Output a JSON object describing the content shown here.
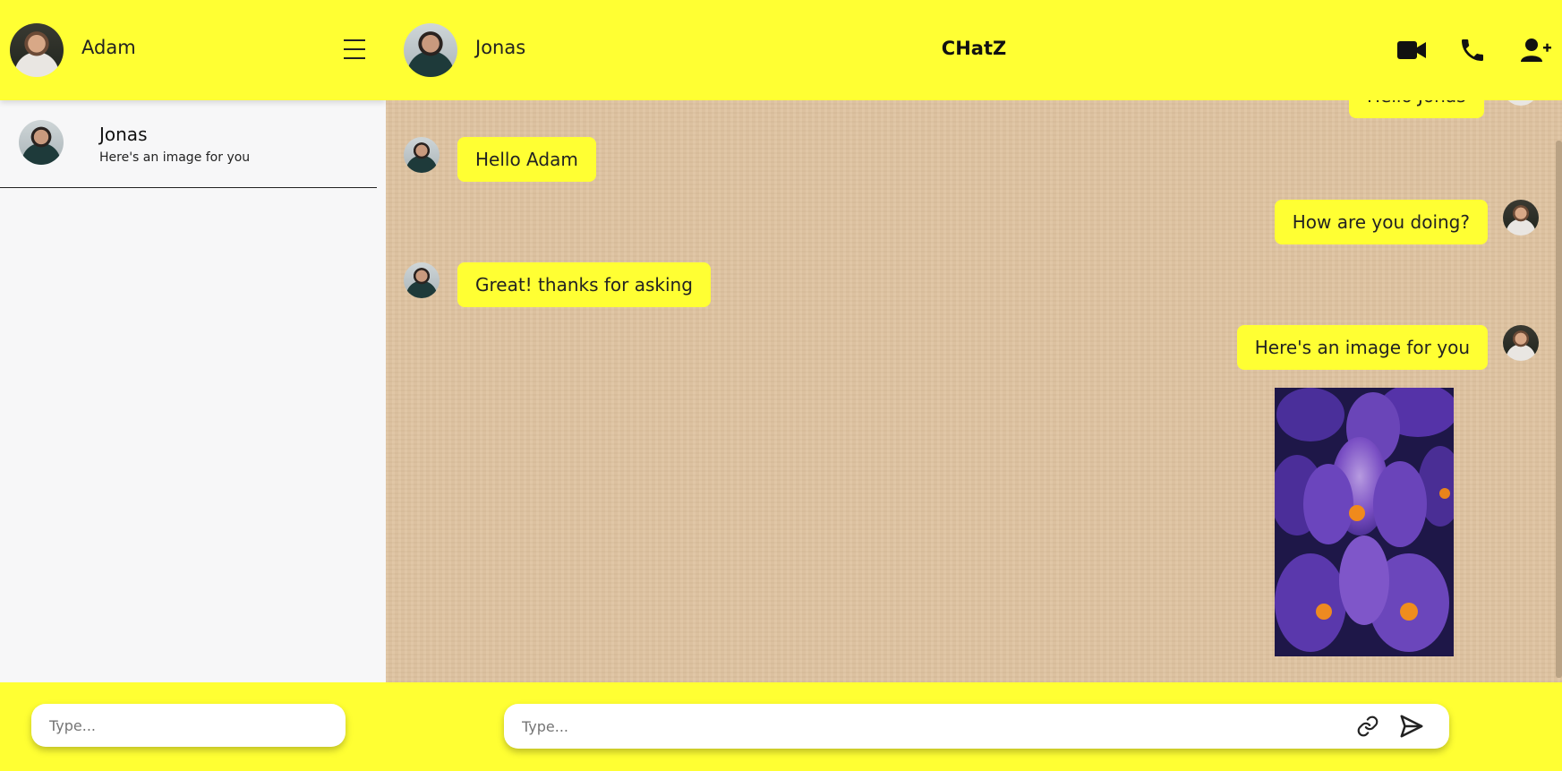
{
  "sidebar": {
    "user_name": "Adam",
    "contacts": [
      {
        "name": "Jonas",
        "preview": "Here's an image for you"
      }
    ],
    "input_placeholder": "Type..."
  },
  "chat": {
    "contact_name": "Jonas",
    "app_title": "CHatZ",
    "partial_message": "Hello Jonas",
    "messages": [
      {
        "from": "Jonas",
        "text": "Hello Adam"
      },
      {
        "from": "Adam",
        "text": "How are you doing?"
      },
      {
        "from": "Jonas",
        "text": "Great! thanks for asking"
      },
      {
        "from": "Adam",
        "text": "Here's an image for you"
      }
    ],
    "input_placeholder": "Type..."
  },
  "icons": {
    "menu": "hamburger-menu-icon",
    "video": "video-camera-icon",
    "call": "phone-icon",
    "add_user": "add-user-icon",
    "attach": "link-icon",
    "send": "send-icon"
  },
  "colors": {
    "accent": "#ffff33",
    "chat_background": "#dfc3a0",
    "sidebar_background": "#f7f7f8"
  }
}
